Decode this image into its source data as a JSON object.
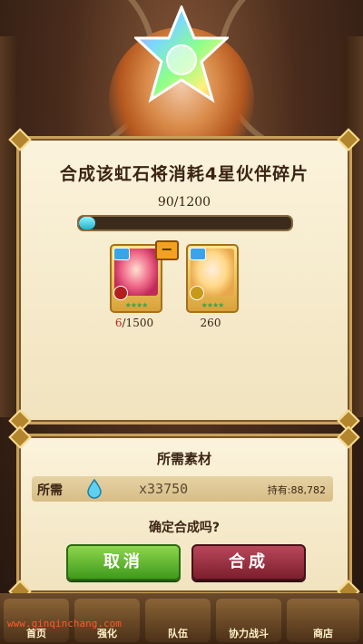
{
  "dialog": {
    "title": "合成该虹石将消耗4星伙伴碎片",
    "progress_text": "90/1200",
    "progress": 0.075,
    "cards": [
      {
        "count_current": "6",
        "count_total": "/1500"
      },
      {
        "count": "260"
      }
    ]
  },
  "materials": {
    "title": "所需素材",
    "required_label": "所需",
    "required_value": "x33750",
    "owned": "持有:88,782",
    "confirm_text": "确定合成吗?",
    "cancel_label": "取消",
    "confirm_label": "合成"
  },
  "nav": {
    "items": [
      "首页",
      "强化",
      "队伍",
      "协力战斗",
      "商店"
    ]
  },
  "watermark": "www.qinqinchang.com",
  "colors": {
    "cancel": "#5cb82c",
    "confirm": "#962a3c",
    "progress": "#1fb4c8"
  }
}
